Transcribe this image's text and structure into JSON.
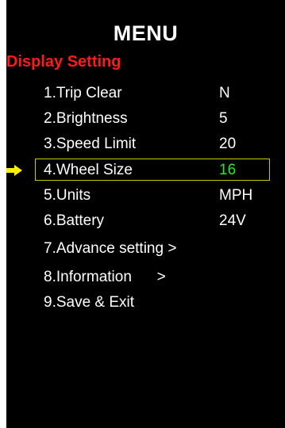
{
  "screen": {
    "title": "MENU",
    "section": "Display Setting"
  },
  "menu": {
    "selected_index": 3,
    "items": [
      {
        "label": "1.Trip Clear",
        "value": "N"
      },
      {
        "label": "2.Brightness",
        "value": "5"
      },
      {
        "label": "3.Speed Limit",
        "value": "20"
      },
      {
        "label": "4.Wheel Size",
        "value": "16"
      },
      {
        "label": "5.Units",
        "value": "MPH"
      },
      {
        "label": "6.Battery",
        "value": "24V"
      },
      {
        "label": "7.Advance setting >",
        "value": ""
      },
      {
        "label": "8.Information      >",
        "value": ""
      },
      {
        "label": "9.Save & Exit",
        "value": ""
      }
    ]
  },
  "colors": {
    "background": "#000000",
    "text": "#ffffff",
    "section": "#ff1a1a",
    "selected_value": "#22ee22",
    "selection_frame": "#c8c800",
    "pointer": "#ffee00"
  },
  "icons": {
    "pointer": "right-arrow-icon"
  }
}
